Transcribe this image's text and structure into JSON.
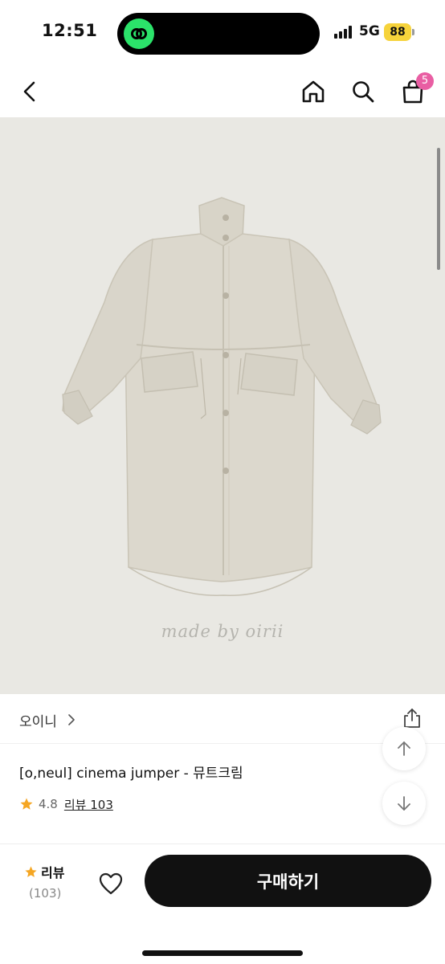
{
  "status_bar": {
    "time": "12:51",
    "network": "5G",
    "battery": "88",
    "island_app_color": "#2be36a"
  },
  "nav": {
    "back_icon": "chevron-left-icon",
    "home_icon": "home-icon",
    "search_icon": "search-icon",
    "cart_icon": "shopping-bag-icon",
    "cart_count": "5",
    "badge_color": "#e95ea3"
  },
  "product": {
    "image_watermark": "made by oirii",
    "brand": "오이니",
    "title": "[o,neul] cinema jumper - 뮤트크림",
    "rating": "4.8",
    "review_link": "리뷰 103",
    "star_color": "#f5a623",
    "image_background": "#e9e8e3"
  },
  "bottom_bar": {
    "review_label": "리뷰",
    "review_count": "(103)",
    "buy_label": "구매하기",
    "buy_color": "#111111"
  }
}
